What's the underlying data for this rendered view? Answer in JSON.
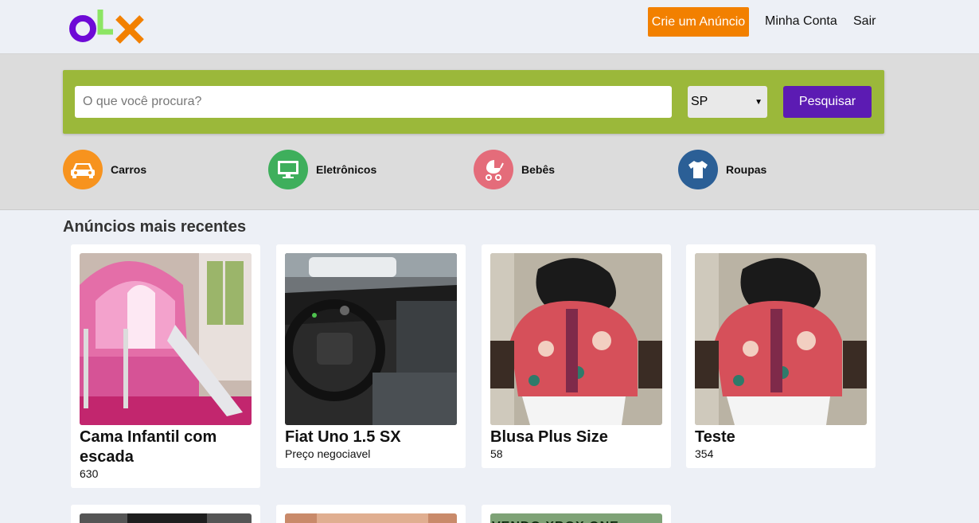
{
  "header": {
    "logo_text": "OLX",
    "create_ad_label": "Crie um Anúncio",
    "account_label": "Minha Conta",
    "logout_label": "Sair"
  },
  "search": {
    "placeholder": "O que você procura?",
    "value": "",
    "state_selected": "SP",
    "button_label": "Pesquisar"
  },
  "categories": [
    {
      "label": "Carros",
      "icon": "car-icon",
      "color": "#f7931e"
    },
    {
      "label": "Eletrônicos",
      "icon": "monitor-icon",
      "color": "#3eaf5c"
    },
    {
      "label": "Bebês",
      "icon": "baby-stroller-icon",
      "color": "#e46c7a"
    },
    {
      "label": "Roupas",
      "icon": "tshirt-icon",
      "color": "#2b5f96"
    }
  ],
  "section_title": "Anúncios mais recentes",
  "ads": [
    {
      "title": "Cama Infantil com escada",
      "price": "630",
      "image": "pink-bunk-bed-photo"
    },
    {
      "title": "Fiat Uno 1.5 SX",
      "price": "Preço negociavel",
      "image": "car-dashboard-photo"
    },
    {
      "title": "Blusa Plus Size",
      "price": "58",
      "image": "floral-blouse-photo"
    },
    {
      "title": "Teste",
      "price": "354",
      "image": "floral-blouse-photo"
    }
  ],
  "ads_row2": [
    {
      "image": "person-photo"
    },
    {
      "image": "hands-photo"
    },
    {
      "image": "xbox-sign-photo",
      "visible_text": "VENDO XBOX ONE"
    }
  ],
  "colors": {
    "accent_orange": "#f28000",
    "brand_purple": "#5c1bb3",
    "search_green": "#9bb83a",
    "page_bg": "#edf0f6"
  }
}
